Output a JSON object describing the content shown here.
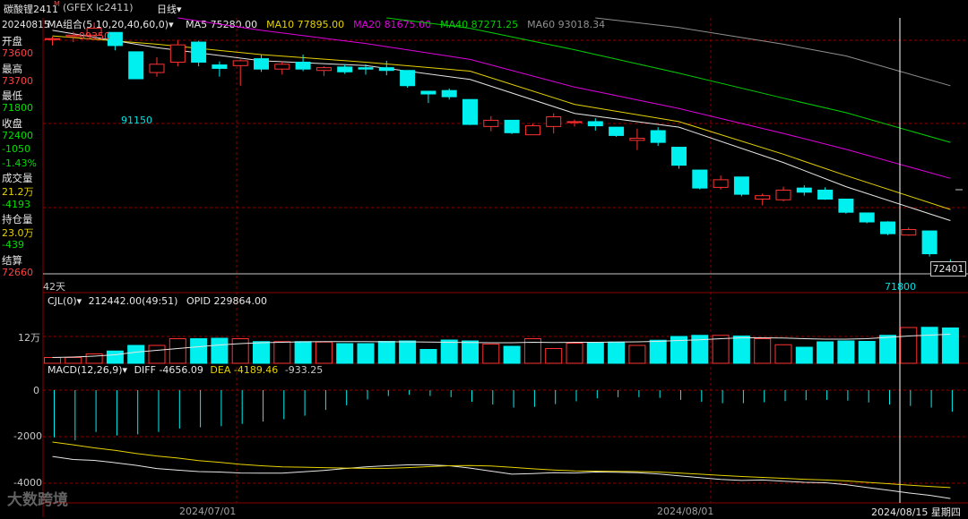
{
  "header": {
    "symbol": "碳酸锂2411",
    "symbol_mark": "M",
    "code": "(GFEX lc2411)",
    "period": "日线",
    "period_arrow": "▾"
  },
  "info_panel": {
    "date": "20240815",
    "items": [
      {
        "label": "开盘",
        "value": "73600",
        "color": "#ff4040"
      },
      {
        "label": "最高",
        "value": "73700",
        "color": "#ff4040"
      },
      {
        "label": "最低",
        "value": "71800",
        "color": "#00e000"
      },
      {
        "label": "收盘",
        "value": "72400",
        "color": "#00e000"
      },
      {
        "label": "",
        "value": "-1050",
        "color": "#00e000"
      },
      {
        "label": "",
        "value": "-1.43%",
        "color": "#00e000"
      },
      {
        "label": "成交量",
        "value": "21.2万",
        "color": "#e6d200"
      },
      {
        "label": "",
        "value": "-4193",
        "color": "#00e000"
      },
      {
        "label": "持仓量",
        "value": "23.0万",
        "color": "#e6d200"
      },
      {
        "label": "",
        "value": "-439",
        "color": "#00e000"
      },
      {
        "label": "结算",
        "value": "72660",
        "color": "#ff4040"
      }
    ]
  },
  "ma_legend": {
    "title": "MA组合(5,10,20,40,60,0)",
    "title_arrow": "▾",
    "items": [
      {
        "label": "MA5 75280.00",
        "color": "#e6e6e6"
      },
      {
        "label": "MA10 77895.00",
        "color": "#e6d200"
      },
      {
        "label": "MA20 81675.00",
        "color": "#e000e0"
      },
      {
        "label": "MA40 87271.25",
        "color": "#00d000"
      },
      {
        "label": "MA60 93018.34",
        "color": "#909090"
      }
    ]
  },
  "annotations": {
    "high_label": "99350",
    "low_label": "91150",
    "last_low_label": "71800",
    "price_tag": "72401",
    "days_label": "42天"
  },
  "cjl_legend": {
    "title": "CJL(0)",
    "title_arrow": "▾",
    "value": "212442.00(49:51)",
    "opid": "OPID 229864.00",
    "axis_tick": "12万"
  },
  "macd_legend": {
    "title": "MACD(12,26,9)",
    "title_arrow": "▾",
    "diff": "DIFF -4656.09",
    "dea": "DEA -4189.46",
    "macd": "-933.25",
    "diff_color": "#e6e6e6",
    "dea_color": "#e6d200",
    "macd_color": "#c8c8c8",
    "ticks": [
      "0",
      "-2000",
      "-4000"
    ]
  },
  "date_axis": {
    "labels": [
      "2024/07/01",
      "2024/08/01"
    ],
    "current": "2024/08/15 星期四"
  },
  "watermark": "大数跨境",
  "colors": {
    "up": "#ff3232",
    "down": "#00f0f0",
    "grid": "#8b0000",
    "ma5": "#e6e6e6",
    "ma10": "#e6d200",
    "ma20": "#e000e0",
    "ma40": "#00d000",
    "ma60": "#909090"
  },
  "chart_data": {
    "type": "candlestick",
    "title": "碳酸锂2411 日线",
    "candles": [
      {
        "o": 97000,
        "h": 97300,
        "l": 96000,
        "c": 97000
      },
      {
        "o": 97300,
        "h": 98000,
        "l": 96500,
        "c": 97500
      },
      {
        "o": 97500,
        "h": 99350,
        "l": 97000,
        "c": 98500
      },
      {
        "o": 97900,
        "h": 97900,
        "l": 95300,
        "c": 96000
      },
      {
        "o": 95100,
        "h": 95100,
        "l": 91150,
        "c": 91200
      },
      {
        "o": 92100,
        "h": 94300,
        "l": 91500,
        "c": 93300
      },
      {
        "o": 93600,
        "h": 96800,
        "l": 93000,
        "c": 96100
      },
      {
        "o": 96500,
        "h": 96700,
        "l": 93000,
        "c": 93600
      },
      {
        "o": 93200,
        "h": 93700,
        "l": 91500,
        "c": 92700
      },
      {
        "o": 93100,
        "h": 94000,
        "l": 90200,
        "c": 93800
      },
      {
        "o": 94100,
        "h": 94700,
        "l": 92200,
        "c": 92600
      },
      {
        "o": 92600,
        "h": 93700,
        "l": 91800,
        "c": 93300
      },
      {
        "o": 93600,
        "h": 94700,
        "l": 92300,
        "c": 92600
      },
      {
        "o": 92400,
        "h": 93000,
        "l": 91600,
        "c": 92800
      },
      {
        "o": 92900,
        "h": 93300,
        "l": 91900,
        "c": 92200
      },
      {
        "o": 92800,
        "h": 93300,
        "l": 91800,
        "c": 92600
      },
      {
        "o": 92800,
        "h": 93800,
        "l": 91700,
        "c": 92400
      },
      {
        "o": 92400,
        "h": 92400,
        "l": 89900,
        "c": 90200
      },
      {
        "o": 89400,
        "h": 89400,
        "l": 87700,
        "c": 89000
      },
      {
        "o": 89500,
        "h": 89800,
        "l": 88200,
        "c": 88600
      },
      {
        "o": 88200,
        "h": 88200,
        "l": 84500,
        "c": 84600
      },
      {
        "o": 84300,
        "h": 85800,
        "l": 83600,
        "c": 85200
      },
      {
        "o": 85200,
        "h": 85200,
        "l": 83200,
        "c": 83400
      },
      {
        "o": 83100,
        "h": 84700,
        "l": 83100,
        "c": 84400
      },
      {
        "o": 84300,
        "h": 86200,
        "l": 83300,
        "c": 85700
      },
      {
        "o": 85000,
        "h": 85300,
        "l": 84300,
        "c": 85000
      },
      {
        "o": 85000,
        "h": 85500,
        "l": 83700,
        "c": 84400
      },
      {
        "o": 84200,
        "h": 84200,
        "l": 82800,
        "c": 83000
      },
      {
        "o": 82300,
        "h": 84000,
        "l": 80900,
        "c": 82600
      },
      {
        "o": 83700,
        "h": 84200,
        "l": 81500,
        "c": 82000
      },
      {
        "o": 81300,
        "h": 81300,
        "l": 78200,
        "c": 78700
      },
      {
        "o": 78000,
        "h": 78000,
        "l": 75200,
        "c": 75400
      },
      {
        "o": 75500,
        "h": 77200,
        "l": 75200,
        "c": 76600
      },
      {
        "o": 77000,
        "h": 77000,
        "l": 74200,
        "c": 74500
      },
      {
        "o": 73800,
        "h": 74600,
        "l": 72900,
        "c": 74300
      },
      {
        "o": 73700,
        "h": 75600,
        "l": 73500,
        "c": 75100
      },
      {
        "o": 75400,
        "h": 75800,
        "l": 74300,
        "c": 74800
      },
      {
        "o": 75100,
        "h": 75500,
        "l": 73700,
        "c": 73800
      },
      {
        "o": 73800,
        "h": 73800,
        "l": 71700,
        "c": 71900
      },
      {
        "o": 71800,
        "h": 71800,
        "l": 70300,
        "c": 70500
      },
      {
        "o": 70500,
        "h": 70600,
        "l": 68600,
        "c": 68800
      },
      {
        "o": 68600,
        "h": 69700,
        "l": 68500,
        "c": 69400
      },
      {
        "o": 69200,
        "h": 69200,
        "l": 65500,
        "c": 65900
      },
      {
        "o": 64500,
        "h": 65100,
        "l": 63700,
        "c": 63800
      }
    ],
    "ma": {
      "MA5": {
        "start": [
          0,
          98200
        ],
        "pts": [
          [
            5,
            95700
          ],
          [
            10,
            93800
          ],
          [
            15,
            93100
          ],
          [
            20,
            91100
          ],
          [
            25,
            86200
          ],
          [
            30,
            84200
          ],
          [
            35,
            79100
          ],
          [
            38,
            75600
          ],
          [
            43,
            70700
          ]
        ]
      },
      "MA10": {
        "start": [
          0,
          97400
        ],
        "pts": [
          [
            5,
            96200
          ],
          [
            10,
            94700
          ],
          [
            15,
            93600
          ],
          [
            20,
            92300
          ],
          [
            25,
            87500
          ],
          [
            30,
            85000
          ],
          [
            35,
            80300
          ],
          [
            38,
            77200
          ],
          [
            43,
            72300
          ]
        ]
      },
      "MA20": {
        "start": [
          6,
          100000
        ],
        "pts": [
          [
            10,
            98200
          ],
          [
            15,
            96300
          ],
          [
            20,
            94000
          ],
          [
            25,
            90000
          ],
          [
            30,
            86900
          ],
          [
            35,
            83300
          ],
          [
            38,
            81000
          ],
          [
            43,
            76800
          ]
        ]
      },
      "MA40": {
        "start": [
          16,
          100000
        ],
        "pts": [
          [
            20,
            98500
          ],
          [
            25,
            95400
          ],
          [
            30,
            92000
          ],
          [
            35,
            88400
          ],
          [
            38,
            86300
          ],
          [
            43,
            82000
          ]
        ]
      },
      "MA60": {
        "start": [
          26,
          100000
        ],
        "pts": [
          [
            30,
            98600
          ],
          [
            35,
            96200
          ],
          [
            38,
            94500
          ],
          [
            43,
            90200
          ]
        ]
      }
    },
    "volume": [
      26,
      26,
      42,
      55,
      80,
      80,
      110,
      110,
      112,
      110,
      97,
      97,
      97,
      95,
      88,
      88,
      98,
      100,
      62,
      104,
      100,
      86,
      76,
      110,
      66,
      90,
      91,
      95,
      80,
      103,
      120,
      125,
      125,
      122,
      110,
      83,
      72,
      96,
      100,
      98,
      125,
      160,
      161,
      158
    ],
    "volume_ma": [
      26,
      28,
      32,
      38,
      50,
      58,
      66,
      74,
      82,
      88,
      92,
      94,
      96,
      97,
      97,
      97,
      96,
      96,
      95,
      94,
      93,
      92,
      92,
      94,
      93,
      94,
      94,
      95,
      96,
      98,
      102,
      105,
      110,
      114,
      114,
      113,
      110,
      108,
      108,
      110,
      116,
      122,
      126,
      130
    ],
    "macd_hist": [
      -2030,
      -2150,
      -1800,
      -1950,
      -1900,
      -1800,
      -1650,
      -1600,
      -1550,
      -1450,
      -1350,
      -1250,
      -1100,
      -850,
      -650,
      -400,
      -250,
      -200,
      -250,
      -300,
      -500,
      -620,
      -750,
      -720,
      -600,
      -480,
      -350,
      -300,
      -300,
      -330,
      -420,
      -500,
      -560,
      -560,
      -520,
      -470,
      -430,
      -420,
      -450,
      -530,
      -620,
      -680,
      -750,
      -930
    ],
    "diff": [
      -2850,
      -2980,
      -3020,
      -3120,
      -3230,
      -3370,
      -3440,
      -3500,
      -3520,
      -3560,
      -3570,
      -3570,
      -3510,
      -3450,
      -3370,
      -3300,
      -3250,
      -3210,
      -3210,
      -3250,
      -3350,
      -3480,
      -3610,
      -3590,
      -3550,
      -3560,
      -3520,
      -3530,
      -3550,
      -3600,
      -3680,
      -3760,
      -3840,
      -3880,
      -3860,
      -3910,
      -3960,
      -3980,
      -4060,
      -4180,
      -4300,
      -4420,
      -4520,
      -4656
    ],
    "dea": [
      -2230,
      -2350,
      -2480,
      -2590,
      -2720,
      -2830,
      -2920,
      -3030,
      -3100,
      -3190,
      -3250,
      -3300,
      -3310,
      -3330,
      -3350,
      -3360,
      -3360,
      -3330,
      -3290,
      -3250,
      -3240,
      -3260,
      -3320,
      -3380,
      -3430,
      -3470,
      -3480,
      -3490,
      -3500,
      -3520,
      -3560,
      -3610,
      -3660,
      -3710,
      -3750,
      -3790,
      -3830,
      -3860,
      -3900,
      -3960,
      -4020,
      -4080,
      -4140,
      -4189
    ],
    "x_dates": [
      "2024/07/01",
      "2024/08/01",
      "2024/08/15"
    ],
    "volume_axis": [
      "12万"
    ],
    "macd_axis": [
      0,
      -2000,
      -4000
    ]
  }
}
